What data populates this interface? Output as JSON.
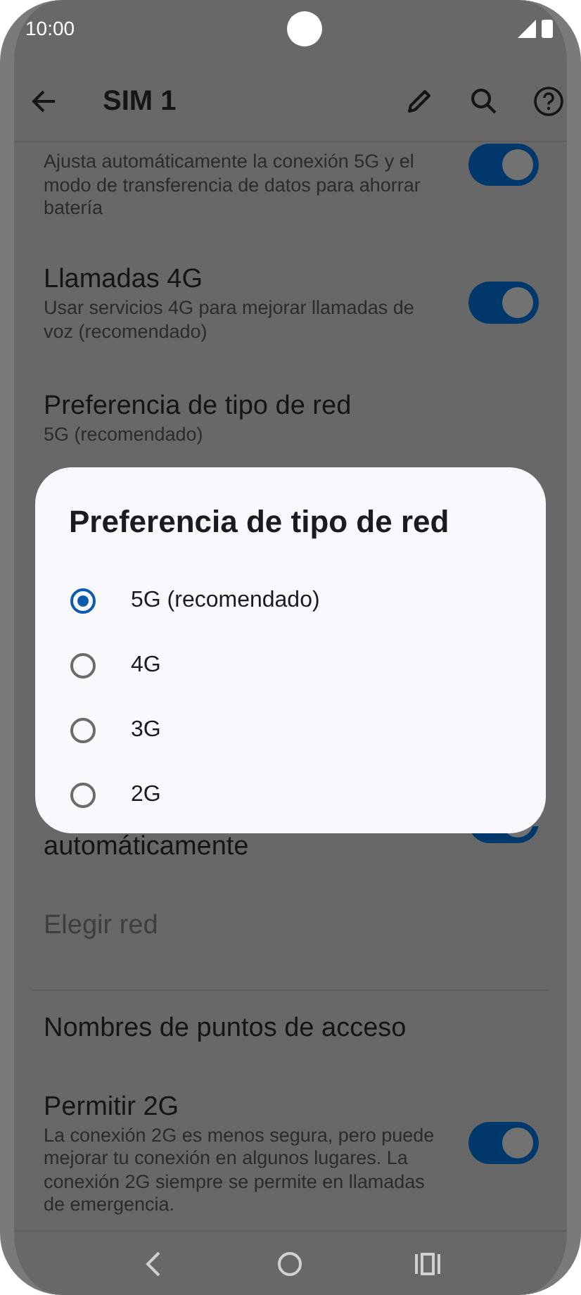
{
  "status_bar": {
    "time": "10:00"
  },
  "app_bar": {
    "title": "SIM 1"
  },
  "settings_above": [
    {
      "kind": "toggle",
      "description": "Ajusta automáticamente la conexión 5G y el modo de transferencia de datos para ahorrar batería",
      "on": true
    },
    {
      "kind": "toggle",
      "title": "Llamadas 4G",
      "description": "Usar servicios 4G para mejorar llamadas de voz (recomendado)",
      "on": true
    },
    {
      "kind": "link",
      "title": "Preferencia de tipo de red",
      "description": "5G (recomendado)"
    }
  ],
  "dialog": {
    "title": "Preferencia de tipo de red",
    "options": [
      {
        "label": "5G (recomendado)",
        "selected": true
      },
      {
        "label": "4G",
        "selected": false
      },
      {
        "label": "3G",
        "selected": false
      },
      {
        "label": "2G",
        "selected": false
      }
    ]
  },
  "settings_below": [
    {
      "kind": "toggle",
      "title": "automáticamente",
      "on": true
    },
    {
      "kind": "link",
      "title": "Elegir red",
      "disabled": true
    },
    {
      "kind": "link",
      "title": "Nombres de puntos de acceso",
      "divider_before": true
    },
    {
      "kind": "toggle",
      "title": "Permitir 2G",
      "description": "La conexión 2G es menos segura, pero puede mejorar tu conexión en algunos lugares. La conexión 2G siempre se permite en llamadas de emergencia.",
      "on": true
    }
  ]
}
